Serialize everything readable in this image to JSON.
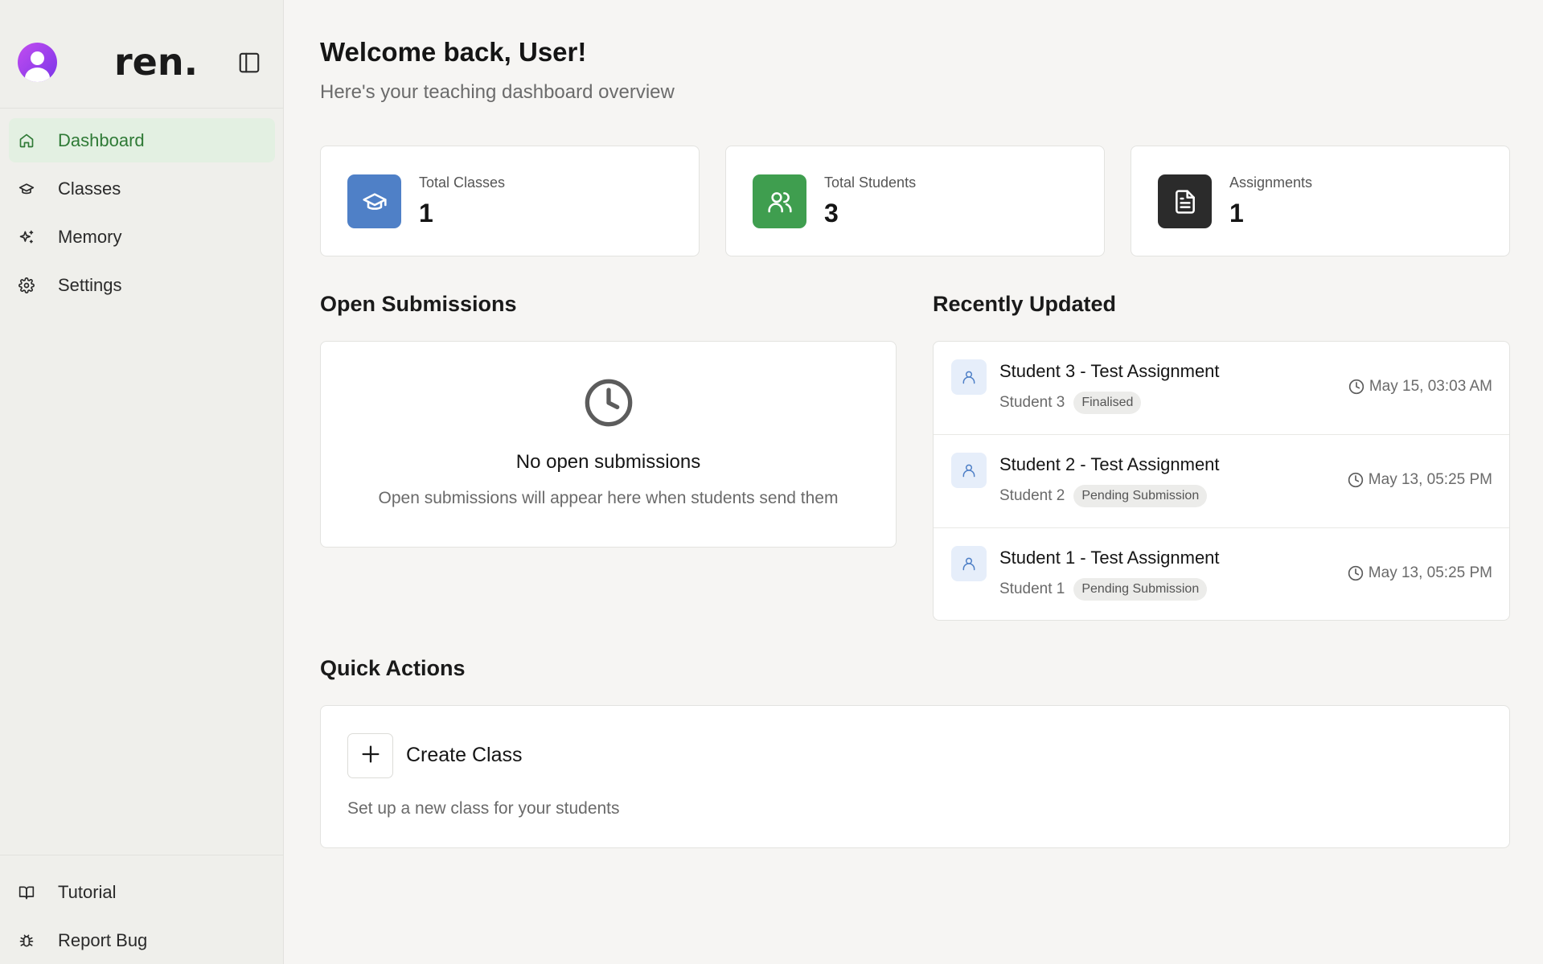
{
  "app": {
    "logo": "ren."
  },
  "sidebar": {
    "items": [
      {
        "label": "Dashboard",
        "icon": "home-icon",
        "active": true
      },
      {
        "label": "Classes",
        "icon": "graduation-cap-icon",
        "active": false
      },
      {
        "label": "Memory",
        "icon": "sparkles-icon",
        "active": false
      },
      {
        "label": "Settings",
        "icon": "gear-icon",
        "active": false
      }
    ],
    "bottom_items": [
      {
        "label": "Tutorial",
        "icon": "book-icon"
      },
      {
        "label": "Report Bug",
        "icon": "bug-icon"
      }
    ]
  },
  "header": {
    "title": "Welcome back, User!",
    "subtitle": "Here's your teaching dashboard overview"
  },
  "stats": [
    {
      "label": "Total Classes",
      "value": "1",
      "icon": "graduation-cap-icon",
      "color": "#4f80c7"
    },
    {
      "label": "Total Students",
      "value": "3",
      "icon": "users-icon",
      "color": "#3f9e4f"
    },
    {
      "label": "Assignments",
      "value": "1",
      "icon": "document-icon",
      "color": "#2b2b2b"
    }
  ],
  "open_submissions": {
    "title": "Open Submissions",
    "empty_title": "No open submissions",
    "empty_text": "Open submissions will appear here when students send them"
  },
  "recently_updated": {
    "title": "Recently Updated",
    "items": [
      {
        "title": "Student 3 - Test Assignment",
        "student": "Student 3",
        "status": "Finalised",
        "time": "May 15, 03:03 AM"
      },
      {
        "title": "Student 2 - Test Assignment",
        "student": "Student 2",
        "status": "Pending Submission",
        "time": "May 13, 05:25 PM"
      },
      {
        "title": "Student 1 - Test Assignment",
        "student": "Student 1",
        "status": "Pending Submission",
        "time": "May 13, 05:25 PM"
      }
    ]
  },
  "quick_actions": {
    "title": "Quick Actions",
    "create_class_label": "Create Class",
    "create_class_desc": "Set up a new class for your students"
  }
}
